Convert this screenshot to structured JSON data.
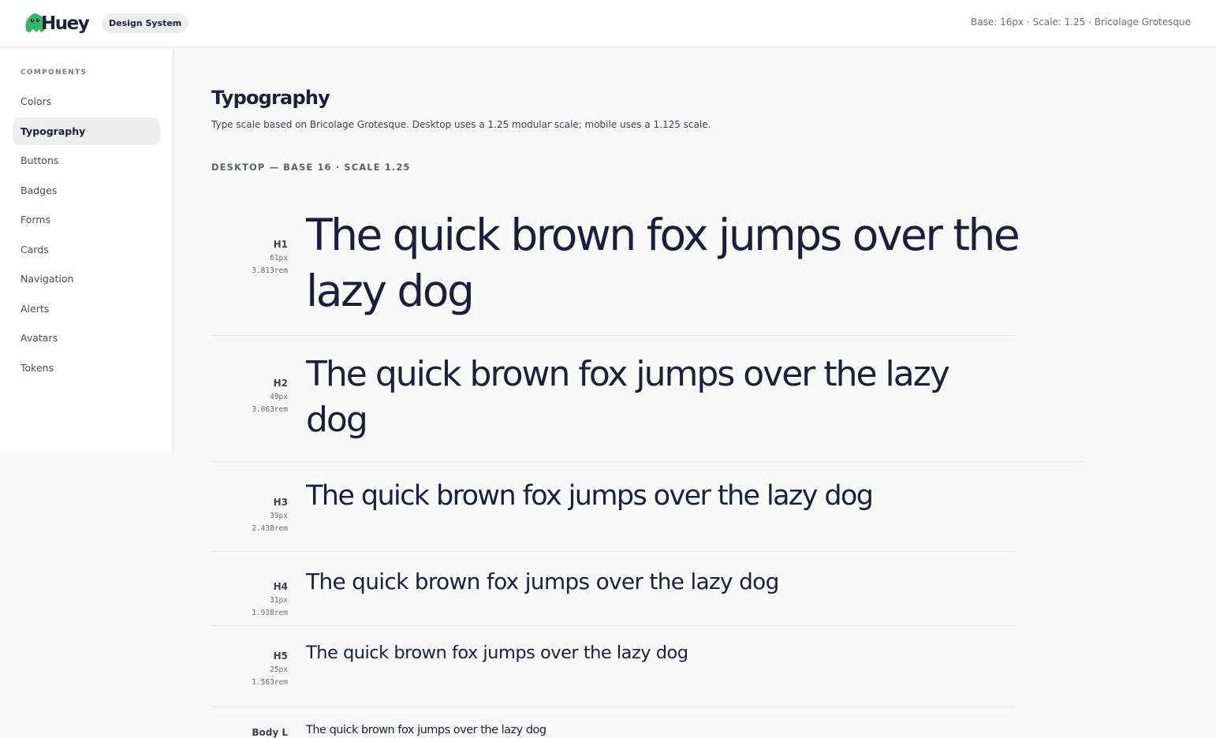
{
  "header": {
    "logo_text": "Huey",
    "badge": "Design System",
    "meta": "Base: 16px · Scale: 1.25 · Bricolage Grotesque",
    "brand_color": "#2fb866"
  },
  "sidebar": {
    "heading": "COMPONENTS",
    "items": [
      {
        "label": "Colors",
        "active": false
      },
      {
        "label": "Typography",
        "active": true
      },
      {
        "label": "Buttons",
        "active": false
      },
      {
        "label": "Badges",
        "active": false
      },
      {
        "label": "Forms",
        "active": false
      },
      {
        "label": "Cards",
        "active": false
      },
      {
        "label": "Navigation",
        "active": false
      },
      {
        "label": "Alerts",
        "active": false
      },
      {
        "label": "Avatars",
        "active": false
      },
      {
        "label": "Tokens",
        "active": false
      }
    ]
  },
  "main": {
    "title": "Typography",
    "description": "Type scale based on Bricolage Grotesque. Desktop uses a 1.25 modular scale; mobile uses a 1.125 scale.",
    "section_label": "DESKTOP — BASE 16 · SCALE 1.25",
    "sample_text": "The quick brown fox jumps over the lazy dog",
    "scale": [
      {
        "tag": "H1",
        "px": "61px",
        "rem": "3.813rem"
      },
      {
        "tag": "H2",
        "px": "49px",
        "rem": "3.063rem"
      },
      {
        "tag": "H3",
        "px": "39px",
        "rem": "2.438rem"
      },
      {
        "tag": "H4",
        "px": "31px",
        "rem": "1.938rem"
      },
      {
        "tag": "H5",
        "px": "25px",
        "rem": "1.563rem"
      },
      {
        "tag": "Body L"
      }
    ]
  }
}
